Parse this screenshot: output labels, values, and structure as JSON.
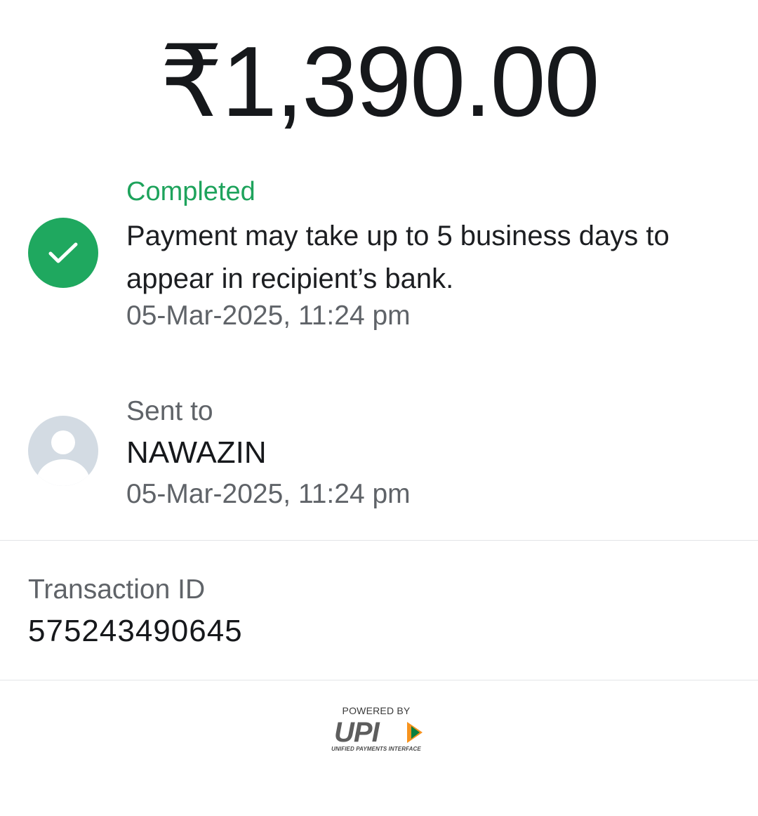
{
  "amount": "₹1,390.00",
  "status": {
    "icon": "check-circle-icon",
    "label": "Completed",
    "message": "Payment may take up to 5 business days to appear in recipient’s bank.",
    "timestamp": "05-Mar-2025, 11:24 pm",
    "color": "#1fa85f"
  },
  "recipient": {
    "icon": "avatar-placeholder-icon",
    "label": "Sent to",
    "name": "NAWAZIN",
    "timestamp": "05-Mar-2025, 11:24 pm"
  },
  "transaction": {
    "label": "Transaction ID",
    "id": "575243490645"
  },
  "footer": {
    "powered_by": "POWERED BY",
    "logo_text": "UPI",
    "logo_subtitle": "UNIFIED PAYMENTS INTERFACE",
    "logo_colors": [
      "#f7931e",
      "#098041",
      "#5d5d5d"
    ]
  }
}
